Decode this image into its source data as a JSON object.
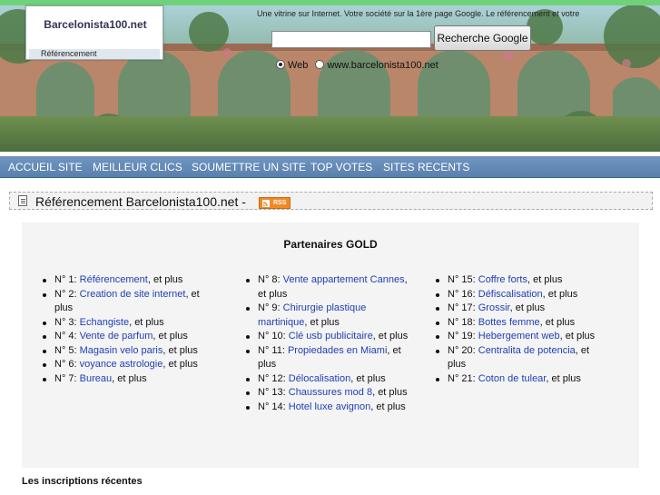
{
  "header": {
    "site_name": "Barcelonista100.net",
    "site_sub": "Référencement",
    "tagline": "Une vitrine sur Internet. Votre société sur la 1ère page Google. Le référencement et votre",
    "search_placeholder": "",
    "search_button": "Recherche Google",
    "radio_web": "Web",
    "radio_site": "www.barcelonista100.net"
  },
  "nav": {
    "items": [
      "ACCUEIL SITE",
      "MEILLEUR CLICS",
      "SOUMETTRE UN SITE",
      "TOP VOTES",
      "SITES RECENTS"
    ]
  },
  "page": {
    "title": "Référencement Barcelonista100.net -",
    "rss_label": "RSS"
  },
  "partners": {
    "title": "Partenaires GOLD",
    "suffix": ", et plus",
    "col1": [
      {
        "num": "N° 1: ",
        "link": "Référencement"
      },
      {
        "num": "N° 2: ",
        "link": "Creation de site internet"
      },
      {
        "num": "N° 3: ",
        "link": "Echangiste"
      },
      {
        "num": "N° 4: ",
        "link": "Vente de parfum"
      },
      {
        "num": "N° 5: ",
        "link": "Magasin velo paris"
      },
      {
        "num": "N° 6: ",
        "link": "voyance astrologie"
      },
      {
        "num": "N° 7: ",
        "link": "Bureau"
      }
    ],
    "col2": [
      {
        "num": "N° 8: ",
        "link": "Vente appartement Cannes"
      },
      {
        "num": "N° 9: ",
        "link": "Chirurgie plastique martinique"
      },
      {
        "num": "N° 10: ",
        "link": "Clé usb publicitaire"
      },
      {
        "num": "N° 11: ",
        "link": "Propiedades en Miami"
      },
      {
        "num": "N° 12: ",
        "link": "Délocalisation"
      },
      {
        "num": "N° 13: ",
        "link": "Chaussures mod 8"
      },
      {
        "num": "N° 14: ",
        "link": "Hotel luxe avignon"
      }
    ],
    "col3": [
      {
        "num": "N° 15: ",
        "link": "Coffre forts"
      },
      {
        "num": "N° 16: ",
        "link": "Défiscalisation"
      },
      {
        "num": "N° 17: ",
        "link": "Grossir"
      },
      {
        "num": "N° 18: ",
        "link": "Bottes femme"
      },
      {
        "num": "N° 19: ",
        "link": "Hebergement web"
      },
      {
        "num": "N° 20: ",
        "link": "Centralita de potencia"
      },
      {
        "num": "N° 21: ",
        "link": "Coton de tulear"
      }
    ]
  },
  "recent": {
    "heading": "Les inscriptions récentes"
  }
}
